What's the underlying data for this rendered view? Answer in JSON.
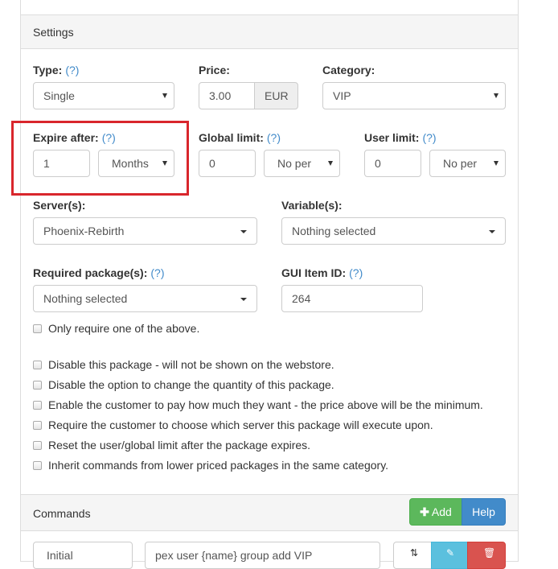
{
  "settings": {
    "heading": "Settings",
    "type": {
      "label": "Type:",
      "help": "(?)",
      "value": "Single"
    },
    "price": {
      "label": "Price:",
      "value": "3.00",
      "currency": "EUR"
    },
    "category": {
      "label": "Category:",
      "value": "VIP"
    },
    "expire": {
      "label": "Expire after:",
      "help": "(?)",
      "amount": "1",
      "unit": "Months"
    },
    "global_limit": {
      "label": "Global limit:",
      "help": "(?)",
      "amount": "0",
      "period": "No per"
    },
    "user_limit": {
      "label": "User limit:",
      "help": "(?)",
      "amount": "0",
      "period": "No per"
    },
    "servers": {
      "label": "Server(s):",
      "value": "Phoenix-Rebirth"
    },
    "variables": {
      "label": "Variable(s):",
      "value": "Nothing selected"
    },
    "required_packages": {
      "label": "Required package(s):",
      "help": "(?)",
      "value": "Nothing selected"
    },
    "gui_item": {
      "label": "GUI Item ID:",
      "help": "(?)",
      "value": "264"
    },
    "only_require_one": "Only require one of the above.",
    "options": [
      "Disable this package - will not be shown on the webstore.",
      "Disable the option to change the quantity of this package.",
      "Enable the customer to pay how much they want - the price above will be the minimum.",
      "Require the customer to choose which server this package will execute upon.",
      "Reset the user/global limit after the package expires.",
      "Inherit commands from lower priced packages in the same category."
    ]
  },
  "commands": {
    "heading": "Commands",
    "add_label": "Add",
    "help_label": "Help",
    "row": {
      "trigger": "Initial",
      "command": "pex user {name} group add VIP"
    }
  },
  "colors": {
    "highlight": "#d9262c",
    "link": "#428bca",
    "success": "#5cb85c",
    "primary": "#428bca",
    "info": "#5bc0de",
    "danger": "#d9534f"
  }
}
